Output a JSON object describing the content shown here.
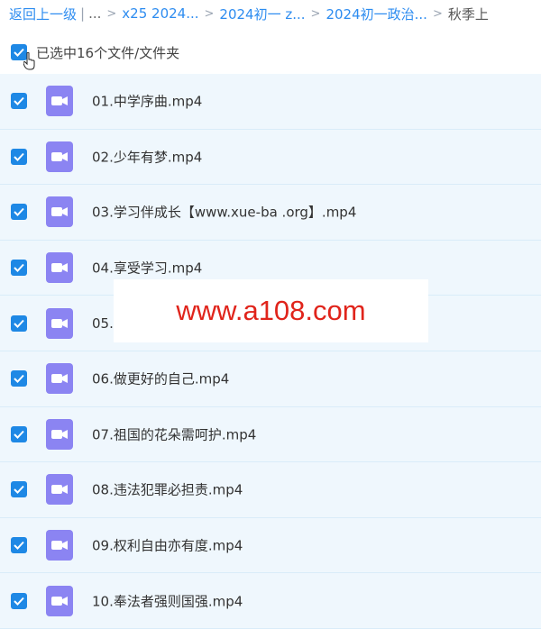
{
  "breadcrumb": {
    "back": "返回上一级",
    "ellipsis": "...",
    "items": [
      "x25 2024...",
      "2024初一 z...",
      "2024初一政治..."
    ],
    "current": "秋季上"
  },
  "selection": {
    "label": "已选中16个文件/文件夹"
  },
  "files": [
    {
      "name": "01.中学序曲.mp4"
    },
    {
      "name": "02.少年有梦.mp4"
    },
    {
      "name": "03.学习伴成长【www.xue-ba .org】.mp4"
    },
    {
      "name": "04.享受学习.mp4"
    },
    {
      "name": "05."
    },
    {
      "name": "06.做更好的自己.mp4"
    },
    {
      "name": "07.祖国的花朵需呵护.mp4"
    },
    {
      "name": "08.违法犯罪必担责.mp4"
    },
    {
      "name": "09.权利自由亦有度.mp4"
    },
    {
      "name": "10.奉法者强则国强.mp4"
    }
  ],
  "watermark": "www.a108.com",
  "colors": {
    "accent": "#1e88e5",
    "row_bg": "#eff7fd",
    "video_icon": "#8b84f2",
    "watermark": "#e0241b"
  }
}
